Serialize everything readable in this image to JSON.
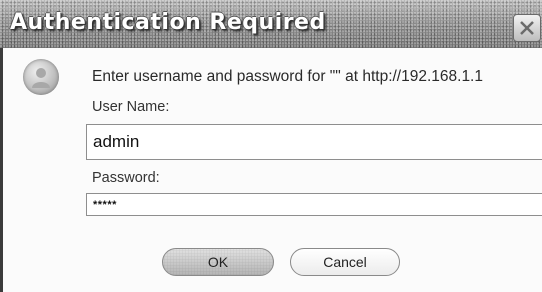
{
  "dialog": {
    "title": "Authentication Required",
    "prompt": "Enter username and password for \"\" at http://192.168.1.1",
    "username_label": "User Name:",
    "username_value": "admin",
    "password_label": "Password:",
    "password_value": "*****",
    "ok_label": "OK",
    "cancel_label": "Cancel"
  },
  "icons": {
    "close": "close-icon",
    "avatar": "user-icon"
  },
  "colors": {
    "titlebar": "#8f8f8f",
    "title_text": "#ffffff",
    "dialog_bg": "#fbfbfb"
  }
}
